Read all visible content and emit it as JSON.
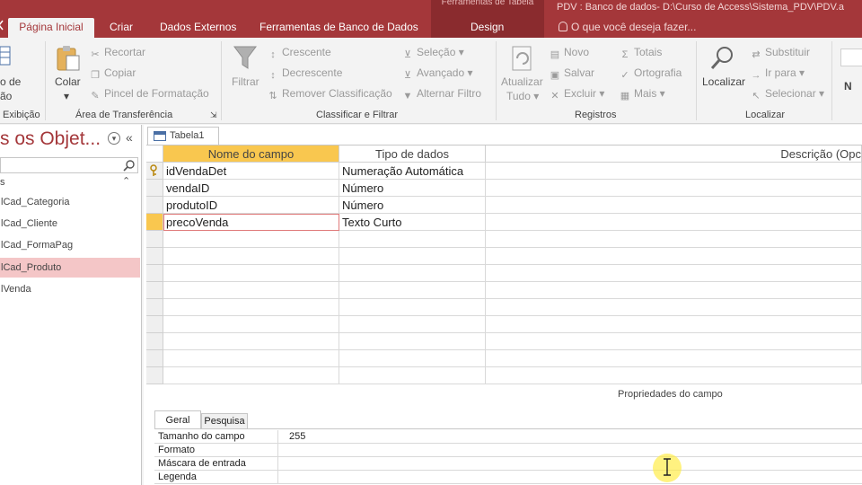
{
  "title_bar": {
    "context_tab_group": "Ferramentas de Tabela",
    "title": "PDV : Banco de dados- D:\\Curso de Access\\Sistema_PDV\\PDV.a",
    "tell_me": "O que você deseja fazer..."
  },
  "tabs": [
    {
      "label": "Página Inicial",
      "active": true
    },
    {
      "label": "Criar",
      "active": false
    },
    {
      "label": "Dados Externos",
      "active": false
    },
    {
      "label": "Ferramentas de Banco de Dados",
      "active": false
    },
    {
      "label": "Design",
      "active": false
    }
  ],
  "ribbon": {
    "exibicao": {
      "label_line1": "o de",
      "label_line2": "ão",
      "group": "Exibição"
    },
    "clipboard": {
      "colar": "Colar",
      "recortar": "Recortar",
      "copiar": "Copiar",
      "pincel": "Pincel de Formatação",
      "group": "Área de Transferência"
    },
    "sort_filter": {
      "filtrar": "Filtrar",
      "crescente": "Crescente",
      "decrescente": "Decrescente",
      "remover": "Remover Classificação",
      "selecao": "Seleção",
      "avancado": "Avançado",
      "alternar": "Alternar Filtro",
      "group": "Classificar e Filtrar"
    },
    "records": {
      "atualizar_line1": "Atualizar",
      "atualizar_line2": "Tudo",
      "novo": "Novo",
      "salvar": "Salvar",
      "excluir": "Excluir",
      "totais": "Totais",
      "ortografia": "Ortografia",
      "mais": "Mais",
      "group": "Registros"
    },
    "find": {
      "localizar": "Localizar",
      "substituir": "Substituir",
      "ir_para": "Ir para",
      "selecionar": "Selecionar",
      "group": "Localizar"
    },
    "font_initial": "N"
  },
  "nav_pane": {
    "title": "s os Objet...",
    "section": "s",
    "items": [
      {
        "label": "lCad_Categoria",
        "selected": false
      },
      {
        "label": "lCad_Cliente",
        "selected": false
      },
      {
        "label": "lCad_FormaPag",
        "selected": false
      },
      {
        "label": "lCad_Produto",
        "selected": true
      },
      {
        "label": "lVenda",
        "selected": false
      }
    ]
  },
  "document": {
    "tab_label": "Tabela1",
    "columns": [
      "Nome do campo",
      "Tipo de dados",
      "Descrição (Opc"
    ],
    "rows": [
      {
        "name": "idVendaDet",
        "type": "Numeração Automática",
        "primary_key": true
      },
      {
        "name": "vendaID",
        "type": "Número",
        "primary_key": false
      },
      {
        "name": "produtoID",
        "type": "Número",
        "primary_key": false
      },
      {
        "name": "precoVenda",
        "type": "Texto Curto",
        "primary_key": false
      }
    ],
    "properties_title": "Propriedades do campo",
    "property_tabs": [
      "Geral",
      "Pesquisa"
    ],
    "properties": [
      {
        "label": "Tamanho do campo",
        "value": "255"
      },
      {
        "label": "Formato",
        "value": ""
      },
      {
        "label": "Máscara de entrada",
        "value": ""
      },
      {
        "label": "Legenda",
        "value": ""
      }
    ]
  },
  "colors": {
    "accent": "#a4373a",
    "selected_nav": "#f4c6c7",
    "active_row_marker": "#f9c74f"
  }
}
